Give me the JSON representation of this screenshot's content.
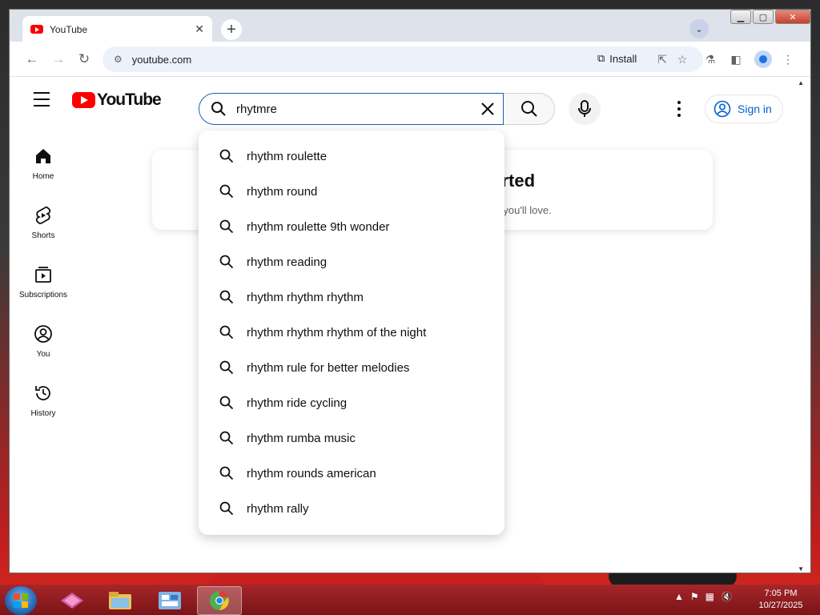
{
  "browser": {
    "tab_title": "YouTube",
    "url": "youtube.com",
    "install_label": "Install"
  },
  "youtube": {
    "logo_text": "YouTube",
    "search_value": "rhytmre",
    "sign_in_label": "Sign in",
    "guide": [
      {
        "label": "Home",
        "icon": "home-icon"
      },
      {
        "label": "Shorts",
        "icon": "shorts-icon"
      },
      {
        "label": "Subscriptions",
        "icon": "subscriptions-icon"
      },
      {
        "label": "You",
        "icon": "you-icon"
      },
      {
        "label": "History",
        "icon": "history-icon"
      }
    ],
    "promo_title_visible": "tarted",
    "promo_subtitle_visible": "deos that you'll love.",
    "suggestions": [
      "rhythm roulette",
      "rhythm round",
      "rhythm roulette 9th wonder",
      "rhythm reading",
      "rhythm rhythm rhythm",
      "rhythm rhythm rhythm of the night",
      "rhythm rule for better melodies",
      "rhythm ride cycling",
      "rhythm rumba music",
      "rhythm rounds american",
      "rhythm rally"
    ]
  },
  "taskbar": {
    "time": "7:05 PM",
    "date": "10/27/2025"
  },
  "colors": {
    "youtube_red": "#ff0000",
    "link_blue": "#065fd4",
    "search_focus": "#1c62b9"
  }
}
